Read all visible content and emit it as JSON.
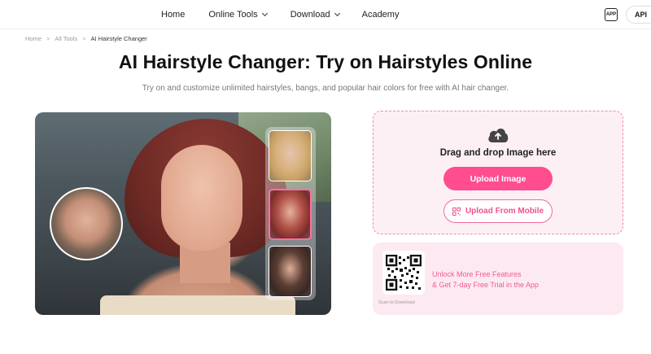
{
  "nav": {
    "items": [
      {
        "label": "Home",
        "dropdown": false
      },
      {
        "label": "Online Tools",
        "dropdown": true
      },
      {
        "label": "Download",
        "dropdown": true
      },
      {
        "label": "Academy",
        "dropdown": false
      }
    ],
    "app_icon_label": "APP",
    "api_label": "API"
  },
  "breadcrumb": {
    "items": [
      "Home",
      "All Tools",
      "AI Hairstyle Changer"
    ],
    "separator": ">"
  },
  "page": {
    "title": "AI Hairstyle Changer: Try on Hairstyles Online",
    "subtitle": "Try on and customize unlimited hairstyles, bangs, and popular hair colors for free with AI hair changer."
  },
  "upload": {
    "icon": "cloud-upload-icon",
    "drag_text": "Drag and drop Image here",
    "upload_button": "Upload Image",
    "mobile_button": "Upload From Mobile"
  },
  "app_promo": {
    "scan_text": "Scan to Download",
    "line1": "Unlock More Free Features",
    "line2": "& Get 7-day Free Trial in the App"
  },
  "colors": {
    "accent": "#ff4d8f",
    "upload_bg": "#fdf0f5",
    "promo_bg": "#fde9f1"
  }
}
